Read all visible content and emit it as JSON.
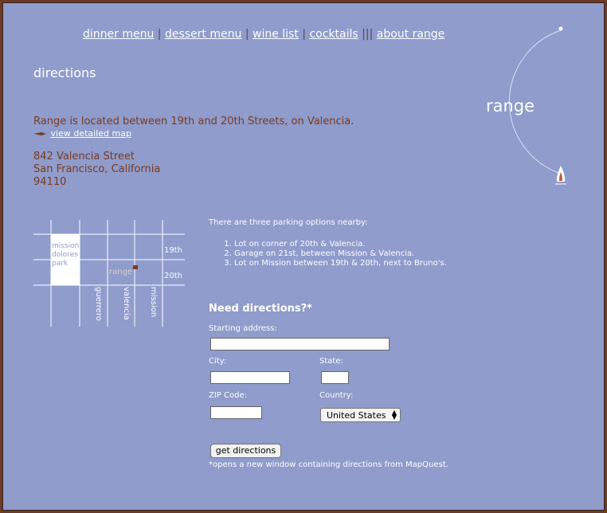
{
  "nav": {
    "items": [
      "dinner menu",
      "dessert menu",
      "wine list",
      "cocktails",
      "about range"
    ],
    "separators": [
      "|",
      "|",
      "|",
      "|||"
    ]
  },
  "page_title": "directions",
  "location": {
    "text": "Range is located between 19th and 20th Streets, on Valencia.",
    "map_link": "view detailed map",
    "address_line1": "842 Valencia Street",
    "address_line2": "San Francisco, California",
    "zip": "94110"
  },
  "logo": {
    "text": "range"
  },
  "map": {
    "park_label_lines": [
      "mission",
      "dolores",
      "park"
    ],
    "street_19th": "19th",
    "street_20th": "20th",
    "marker_label": "range",
    "street_guerrero": "guerrero",
    "street_valencia": "valencia",
    "street_mission": "mission"
  },
  "parking": {
    "intro": "There are three parking options nearby:",
    "options": [
      "Lot on corner of 20th & Valencia.",
      "Garage on 21st, between Mission & Valencia.",
      "Lot on Mission between 19th & 20th, next to Bruno's."
    ]
  },
  "form": {
    "heading": "Need directions?*",
    "starting_address_label": "Starting address:",
    "starting_address_value": "",
    "city_label": "City:",
    "city_value": "",
    "state_label": "State:",
    "state_value": "",
    "zip_label": "ZIP Code:",
    "zip_value": "",
    "country_label": "Country:",
    "country_selected": "United States",
    "submit_label": "get directions",
    "note": "*opens a new window containing directions from MapQuest."
  },
  "colors": {
    "background": "#8f9ccc",
    "border": "#6b3a2a",
    "text_brown": "#7a3a20",
    "accent_flame": "#b85a3a"
  }
}
